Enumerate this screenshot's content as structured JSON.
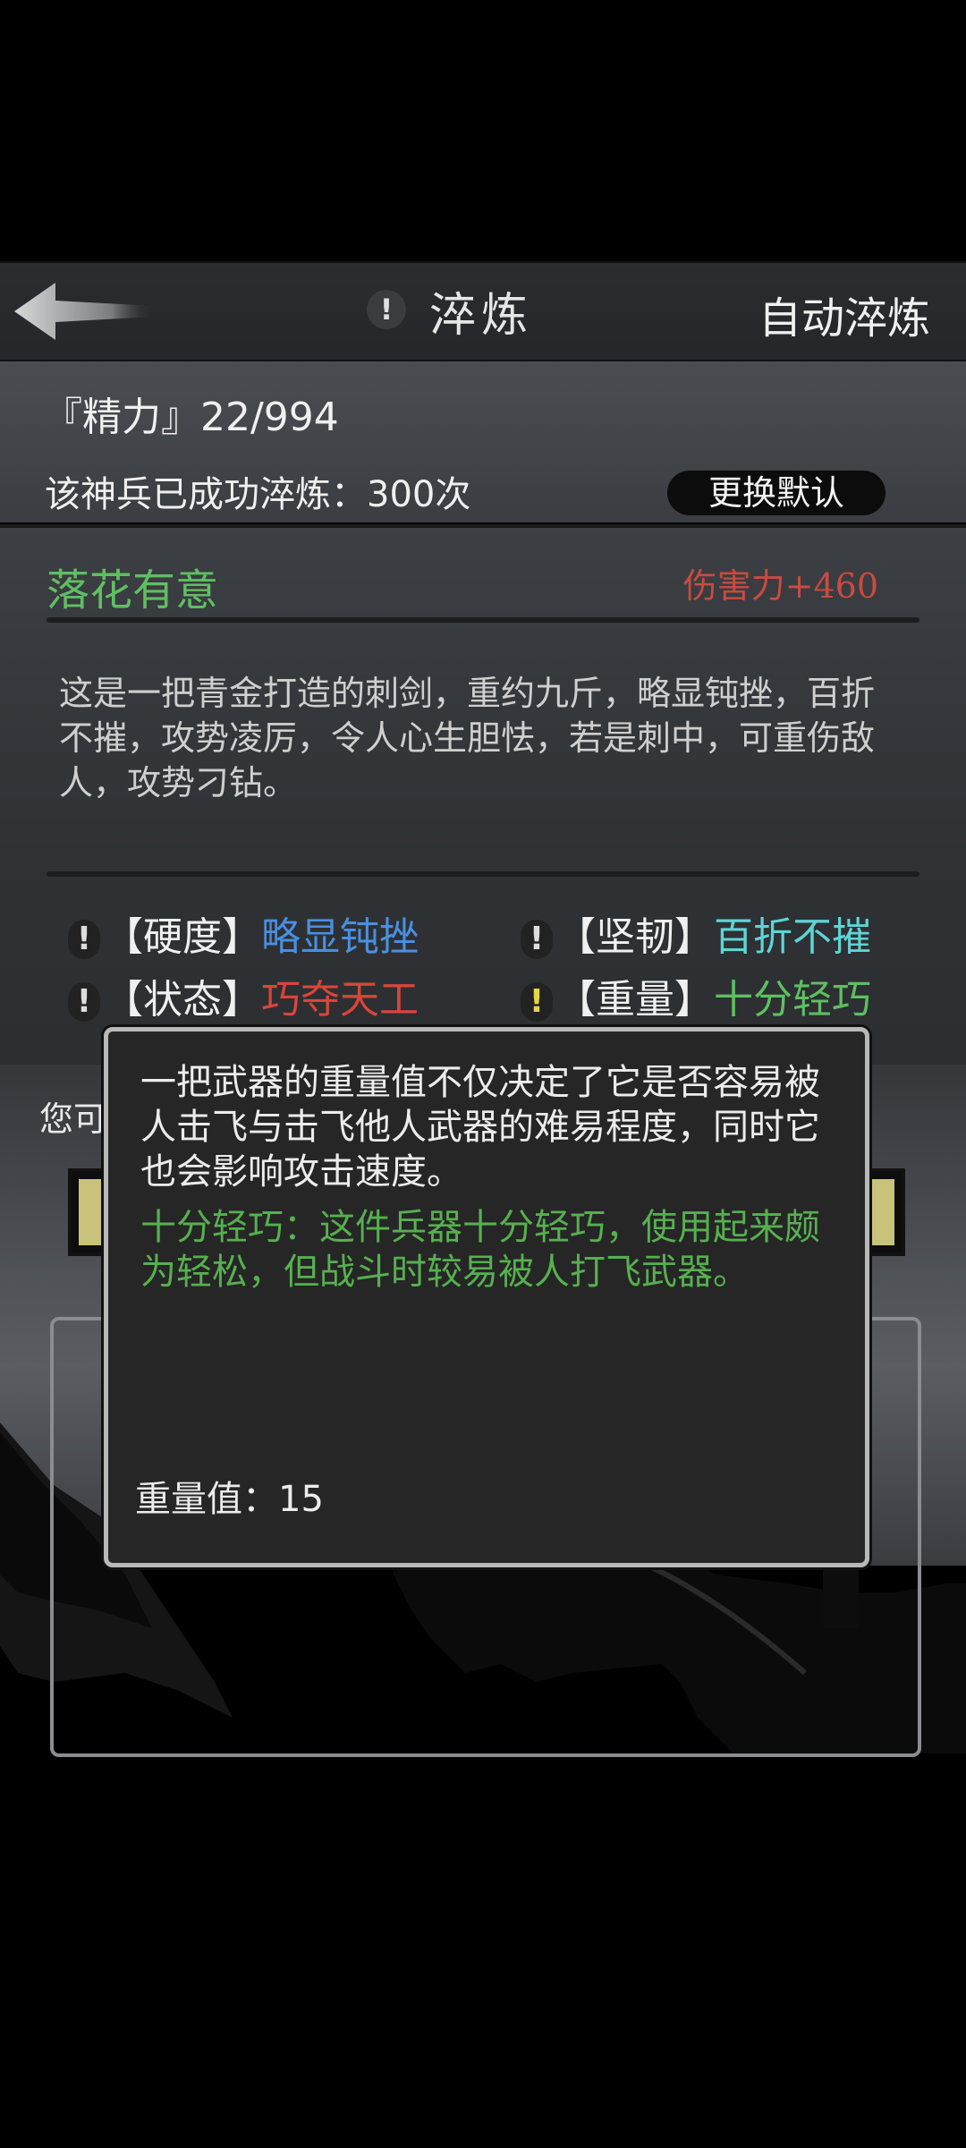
{
  "header": {
    "title": "淬炼",
    "info_glyph": "!",
    "auto_button": "自动淬炼",
    "back_icon": "back-arrow-icon"
  },
  "info": {
    "energy": "『精力』22/994",
    "refine_count": "该神兵已成功淬炼：300次",
    "change_default_button": "更换默认"
  },
  "weapon": {
    "name": "落花有意",
    "damage": "伤害力+460",
    "description": "这是一把青金打造的刺剑，重约九斤，略显钝挫，百折不摧，攻势凌厉，令人心生胆怯，若是刺中，可重伤敌人，攻势刁钻。",
    "attributes": [
      {
        "key": "【硬度】",
        "value": "略显钝挫",
        "color": "#4a8fe0"
      },
      {
        "key": "【坚韧】",
        "value": "百折不摧",
        "color": "#5fd4d4"
      },
      {
        "key": "【状态】",
        "value": "巧夺天工",
        "color": "#d9453b"
      },
      {
        "key": "【重量】",
        "value": "十分轻巧",
        "color": "#5fbf62"
      }
    ]
  },
  "lower": {
    "partial_text": "您可"
  },
  "tooltip": {
    "description": "一把武器的重量值不仅决定了它是否容易被人击飞与击飞他人武器的难易程度，同时它也会影响攻击速度。",
    "detail": "十分轻巧：这件兵器十分轻巧，使用起来颇为轻松，但战斗时较易被人打飞武器。",
    "weight_value": "重量值：15"
  },
  "colors": {
    "green": "#5fbf62",
    "red": "#c94b41",
    "blue": "#4a8fe0",
    "cyan": "#5fd4d4",
    "yellow": "#e6d44a"
  }
}
